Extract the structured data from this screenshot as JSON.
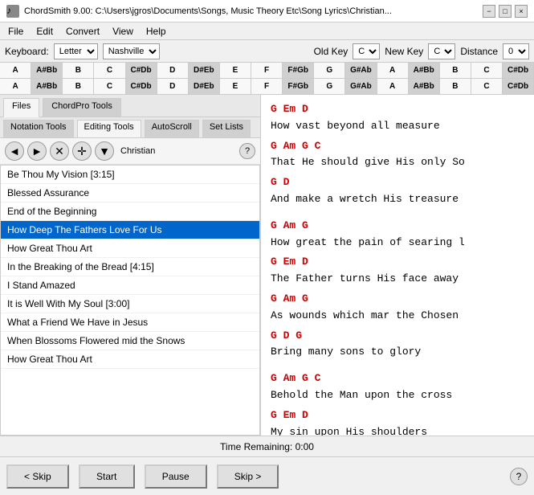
{
  "titleBar": {
    "icon": "♪",
    "title": "ChordSmith  9.00: C:\\Users\\jgros\\Documents\\Songs, Music Theory Etc\\Song Lyrics\\Christian...",
    "minimizeLabel": "−",
    "maximizeLabel": "□",
    "closeLabel": "×"
  },
  "menuBar": {
    "items": [
      "File",
      "Edit",
      "Convert",
      "View",
      "Help"
    ]
  },
  "keyboardToolbar": {
    "keyboardLabel": "Keyboard:",
    "keyboardValue": "Letter",
    "nashvilleValue": "Nashville",
    "oldKeyLabel": "Old Key",
    "oldKeyValue": "C",
    "newKeyLabel": "New Key",
    "newKeyValue": "C",
    "distanceLabel": "Distance",
    "distanceValue": "0"
  },
  "pianoRow1": [
    "A",
    "A#Bb",
    "B",
    "C",
    "C#Db",
    "D",
    "D#Eb",
    "E",
    "F",
    "F#Gb",
    "G",
    "G#Ab",
    "A",
    "A#Bb",
    "B",
    "C",
    "C#Db"
  ],
  "pianoRow2": [
    "A",
    "A#Bb",
    "B",
    "C",
    "C#Db",
    "D",
    "D#Eb",
    "E",
    "F",
    "F#Gb",
    "G",
    "G#Ab",
    "A",
    "A#Bb",
    "B",
    "C",
    "C#Db"
  ],
  "pianoRow1Types": [
    "white",
    "black",
    "white",
    "white",
    "black",
    "white",
    "black",
    "white",
    "white",
    "black",
    "white",
    "black",
    "white",
    "black",
    "white",
    "white",
    "black"
  ],
  "pianoRow2Types": [
    "white",
    "black",
    "white",
    "white",
    "black",
    "white",
    "black",
    "white",
    "white",
    "black",
    "white",
    "black",
    "white",
    "black",
    "white",
    "white",
    "black"
  ],
  "tabs": {
    "main": [
      "Files",
      "ChordPro Tools"
    ],
    "sub": [
      "Notation Tools",
      "Editing Tools",
      "AutoScroll",
      "Set Lists"
    ],
    "activeMain": 0,
    "activeSub": 1
  },
  "toolbar": {
    "prevBtn": "◄",
    "nextBtn": "►",
    "closeBtn": "✕",
    "moveBtn": "✛",
    "downBtn": "▼",
    "songName": "Christian",
    "helpBtn": "?"
  },
  "songList": [
    {
      "title": "Be Thou My Vision [3:15]",
      "selected": false
    },
    {
      "title": "Blessed Assurance",
      "selected": false
    },
    {
      "title": "End of the Beginning",
      "selected": false
    },
    {
      "title": "How Deep The Fathers Love For Us",
      "selected": true
    },
    {
      "title": "How Great Thou Art",
      "selected": false
    },
    {
      "title": "In the Breaking of the Bread [4:15]",
      "selected": false
    },
    {
      "title": "I Stand Amazed",
      "selected": false
    },
    {
      "title": "It is Well With My Soul [3:00]",
      "selected": false
    },
    {
      "title": "What a Friend We Have in Jesus",
      "selected": false
    },
    {
      "title": "When Blossoms Flowered mid the Snows",
      "selected": false
    },
    {
      "title": "How Great Thou Art",
      "selected": false
    }
  ],
  "lyrics": [
    {
      "type": "chord",
      "text": "G                    Em  D"
    },
    {
      "type": "lyric",
      "text": "How vast beyond all measure"
    },
    {
      "type": "chord",
      "text": "G               Am  G  C"
    },
    {
      "type": "lyric",
      "text": "That He should give His only So"
    },
    {
      "type": "chord",
      "text": "G               D"
    },
    {
      "type": "lyric",
      "text": "And make a wretch His treasure"
    },
    {
      "type": "blank"
    },
    {
      "type": "chord",
      "text": "G              Am  G"
    },
    {
      "type": "lyric",
      "text": "How great the pain of searing l"
    },
    {
      "type": "chord",
      "text": "G          Em  D"
    },
    {
      "type": "lyric",
      "text": "The Father turns His face away"
    },
    {
      "type": "chord",
      "text": "G              Am  G"
    },
    {
      "type": "lyric",
      "text": "As wounds which mar the Chosen"
    },
    {
      "type": "chord",
      "text": "G          D  G"
    },
    {
      "type": "lyric",
      "text": "Bring many sons to glory"
    },
    {
      "type": "blank"
    },
    {
      "type": "chord",
      "text": "G          Am  G  C"
    },
    {
      "type": "lyric",
      "text": "Behold the Man upon the cross"
    },
    {
      "type": "chord",
      "text": "G         Em  D"
    },
    {
      "type": "lyric",
      "text": "My sin upon His shoulders"
    }
  ],
  "statusBar": {
    "label": "Time Remaining:  0:00"
  },
  "bottomButtons": {
    "skipBack": "< Skip",
    "start": "Start",
    "pause": "Pause",
    "skipForward": "Skip >",
    "help": "?"
  }
}
